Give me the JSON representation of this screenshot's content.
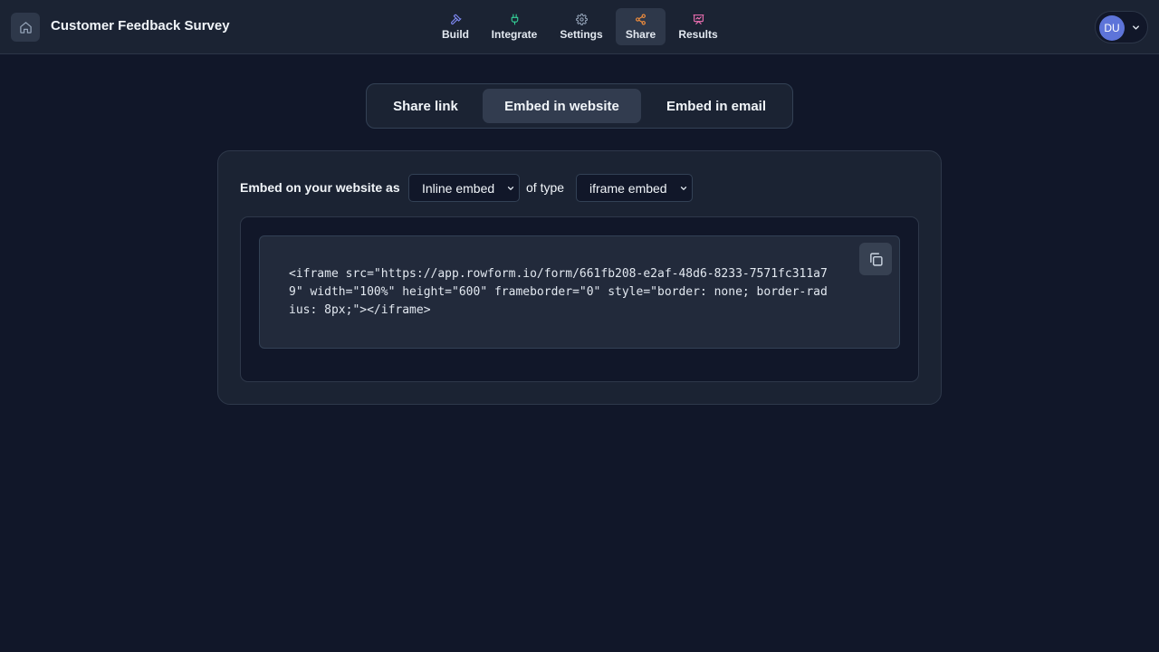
{
  "header": {
    "title": "Customer Feedback Survey",
    "nav": [
      {
        "label": "Build",
        "icon": "hammer-icon",
        "color": "#818cf8"
      },
      {
        "label": "Integrate",
        "icon": "plug-icon",
        "color": "#34d399"
      },
      {
        "label": "Settings",
        "icon": "gear-icon",
        "color": "#94a3b8"
      },
      {
        "label": "Share",
        "icon": "share-icon",
        "color": "#fb923c",
        "active": true
      },
      {
        "label": "Results",
        "icon": "presentation-chart-icon",
        "color": "#f472b6"
      }
    ],
    "user_initials": "DU"
  },
  "share_tabs": [
    {
      "label": "Share link"
    },
    {
      "label": "Embed in website",
      "active": true
    },
    {
      "label": "Embed in email"
    }
  ],
  "embed": {
    "label": "Embed on your website as",
    "mode_value": "Inline embed",
    "of_type_label": "of type",
    "type_value": "iframe embed",
    "code": "<iframe src=\"https://app.rowform.io/form/661fb208-e2af-48d6-8233-7571fc311a79\" width=\"100%\" height=\"600\" frameborder=\"0\" style=\"border: none; border-radius: 8px;\"></iframe>"
  }
}
